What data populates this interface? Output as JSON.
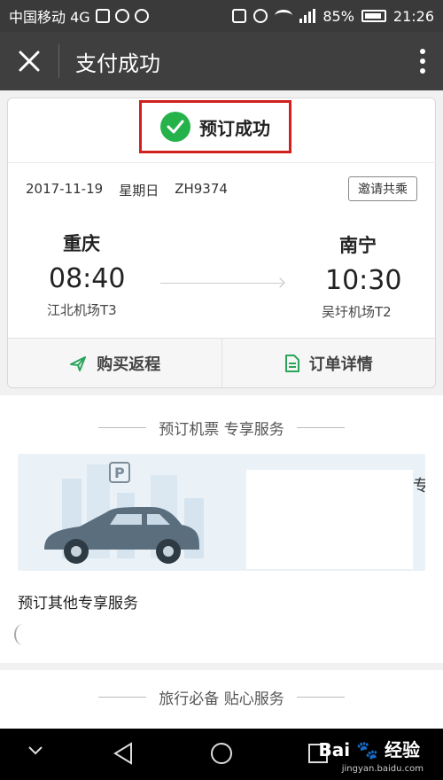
{
  "status_bar": {
    "carrier": "中国移动 4G",
    "battery": "85%",
    "time": "21:26"
  },
  "title_bar": {
    "title": "支付成功",
    "close_icon": "close-icon",
    "more_icon": "more-vertical-icon"
  },
  "booking": {
    "status": "预订成功",
    "date": "2017-11-19",
    "weekday": "星期日",
    "flight_no": "ZH9374",
    "invite_label": "邀请共乘",
    "departure": {
      "city": "重庆",
      "time": "08:40",
      "airport": "江北机场T3"
    },
    "arrival": {
      "city": "南宁",
      "time": "10:30",
      "airport": "吴圩机场T2"
    },
    "actions": [
      {
        "label": "购买返程",
        "icon": "plane-icon"
      },
      {
        "label": "订单详情",
        "icon": "document-icon"
      }
    ]
  },
  "services": {
    "header": "预订机票 专享服务",
    "banner_icon_text": "P",
    "banner_edge_text": "专",
    "other_label": "预订其他专享服务",
    "travel_header": "旅行必备 贴心服务"
  },
  "watermark": {
    "brand": "Bai",
    "brand_suffix": "经验",
    "sub": "jingyan.baidu.com"
  },
  "colors": {
    "success_green": "#25b24a",
    "highlight_red": "#d02020",
    "toolbar_dark": "#3f3f3f",
    "car_body": "#5a6e7e"
  }
}
